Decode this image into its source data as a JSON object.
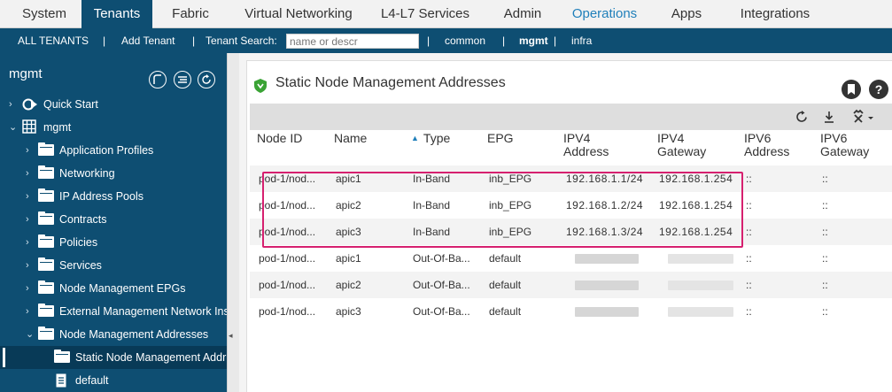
{
  "topnav": {
    "tabs": [
      {
        "label": "System"
      },
      {
        "label": "Tenants"
      },
      {
        "label": "Fabric"
      },
      {
        "label": "Virtual Networking"
      },
      {
        "label": "L4-L7 Services"
      },
      {
        "label": "Admin"
      },
      {
        "label": "Operations"
      },
      {
        "label": "Apps"
      },
      {
        "label": "Integrations"
      }
    ],
    "active": "Tenants"
  },
  "subnav": {
    "all_tenants": "ALL TENANTS",
    "sep": "|",
    "add_tenant": "Add Tenant",
    "search_label": "Tenant Search:",
    "search_placeholder": "name or descr",
    "common": "common",
    "mgmt": "mgmt",
    "infra": "infra"
  },
  "sidebar": {
    "title": "mgmt",
    "tree": [
      {
        "label": "Quick Start",
        "icon": "quick-start-icon",
        "chevron": "›"
      },
      {
        "label": "mgmt",
        "icon": "tenant-grid-icon",
        "chevron": "⌄"
      },
      {
        "label": "Application Profiles",
        "icon": "folder-icon",
        "chevron": "›"
      },
      {
        "label": "Networking",
        "icon": "folder-icon",
        "chevron": "›"
      },
      {
        "label": "IP Address Pools",
        "icon": "folder-icon",
        "chevron": "›"
      },
      {
        "label": "Contracts",
        "icon": "folder-icon",
        "chevron": "›"
      },
      {
        "label": "Policies",
        "icon": "folder-icon",
        "chevron": "›"
      },
      {
        "label": "Services",
        "icon": "folder-icon",
        "chevron": "›"
      },
      {
        "label": "Node Management EPGs",
        "icon": "folder-icon",
        "chevron": "›"
      },
      {
        "label": "External Management Network Ins",
        "icon": "folder-icon",
        "chevron": "›"
      },
      {
        "label": "Node Management Addresses",
        "icon": "folder-icon",
        "chevron": "⌄"
      },
      {
        "label": "Static Node Management Addr",
        "icon": "folder-icon",
        "chevron": ""
      },
      {
        "label": "default",
        "icon": "document-icon",
        "chevron": ""
      }
    ]
  },
  "main": {
    "title": "Static Node Management Addresses",
    "help": "?",
    "columns": [
      {
        "label": "Node ID"
      },
      {
        "label": "Name"
      },
      {
        "label": "Type",
        "sorted": true
      },
      {
        "label": "EPG"
      },
      {
        "label": "IPV4 Address"
      },
      {
        "label": "IPV4 Gateway"
      },
      {
        "label": "IPV6 Address"
      },
      {
        "label": "IPV6 Gateway"
      }
    ],
    "rows": [
      {
        "node": "pod-1/nod...",
        "name": "apic1",
        "type": "In-Band",
        "epg": "inb_EPG",
        "ipv4": "192.168.1.1/24",
        "gw4": "192.168.1.254",
        "ipv6": "::",
        "gw6": "::"
      },
      {
        "node": "pod-1/nod...",
        "name": "apic2",
        "type": "In-Band",
        "epg": "inb_EPG",
        "ipv4": "192.168.1.2/24",
        "gw4": "192.168.1.254",
        "ipv6": "::",
        "gw6": "::"
      },
      {
        "node": "pod-1/nod...",
        "name": "apic3",
        "type": "In-Band",
        "epg": "inb_EPG",
        "ipv4": "192.168.1.3/24",
        "gw4": "192.168.1.254",
        "ipv6": "::",
        "gw6": "::"
      },
      {
        "node": "pod-1/nod...",
        "name": "apic1",
        "type": "Out-Of-Ba...",
        "epg": "default",
        "ipv4": "",
        "gw4": "",
        "ipv6": "::",
        "gw6": "::"
      },
      {
        "node": "pod-1/nod...",
        "name": "apic2",
        "type": "Out-Of-Ba...",
        "epg": "default",
        "ipv4": "",
        "gw4": "",
        "ipv6": "::",
        "gw6": "::"
      },
      {
        "node": "pod-1/nod...",
        "name": "apic3",
        "type": "Out-Of-Ba...",
        "epg": "default",
        "ipv4": "",
        "gw4": "",
        "ipv6": "::",
        "gw6": "::"
      }
    ]
  },
  "colors": {
    "nav": "#0e4e72",
    "accent": "#1f7fba",
    "highlight": "#d6206f",
    "shield": "#3aa335"
  }
}
